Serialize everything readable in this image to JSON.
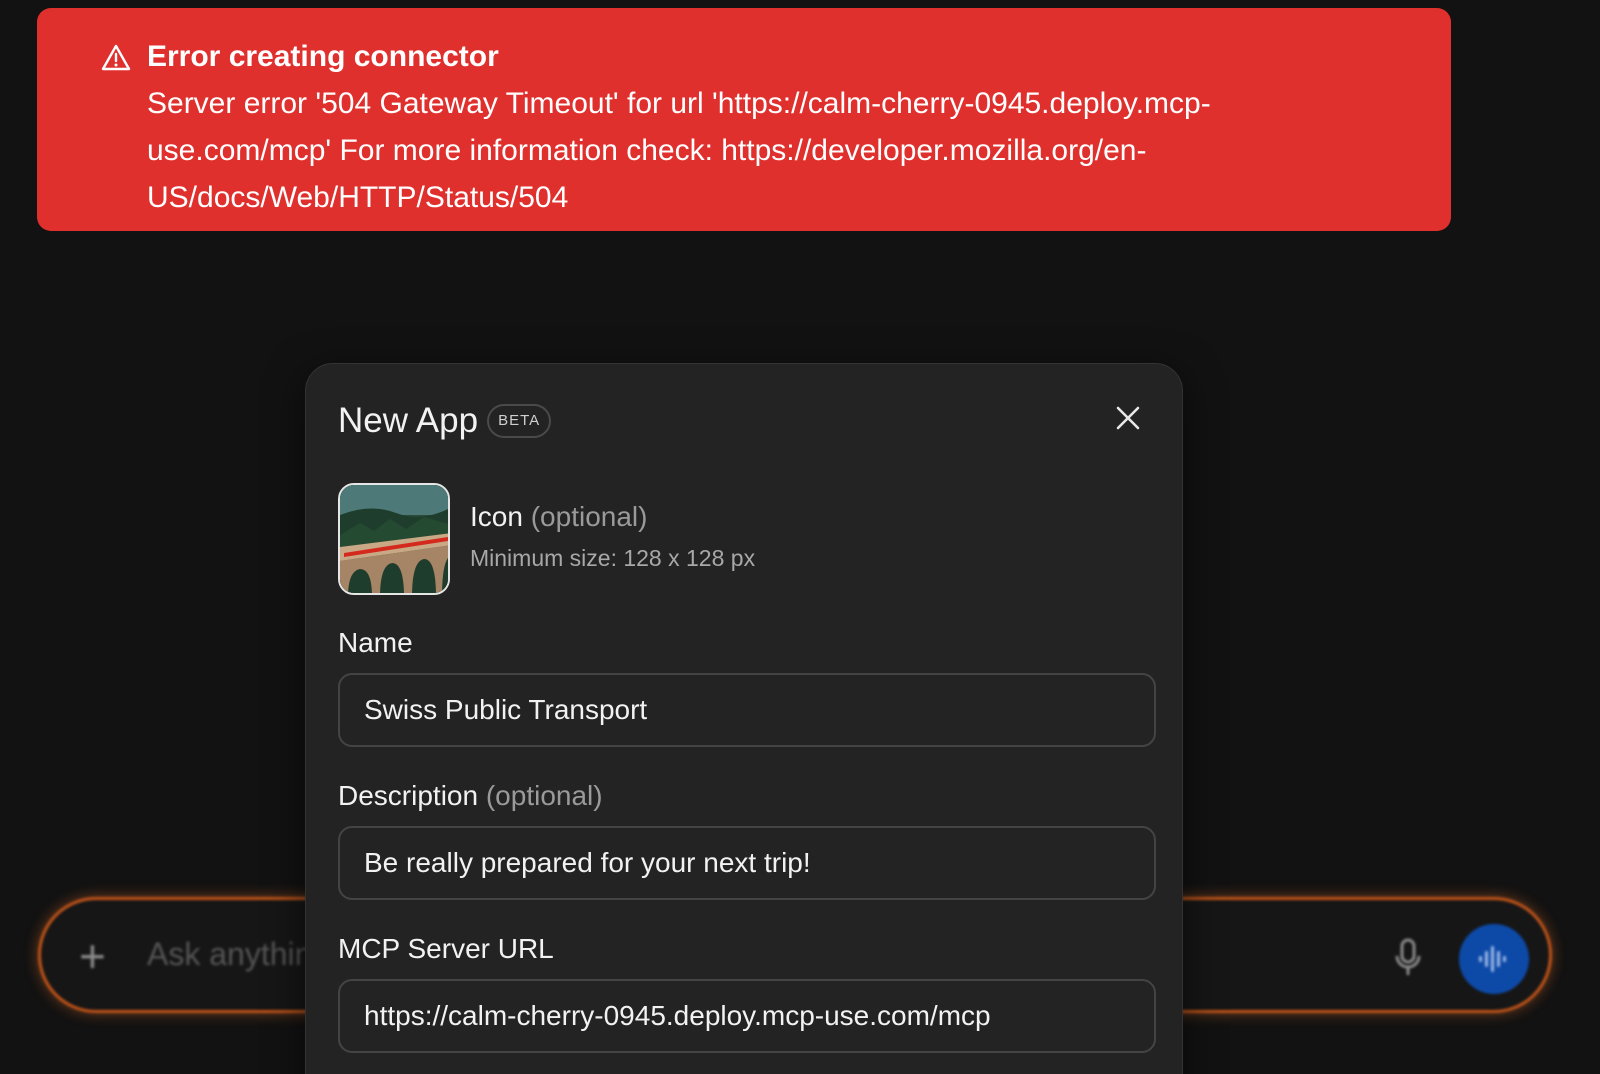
{
  "toast": {
    "title": "Error creating connector",
    "message": "Server error '504 Gateway Timeout' for url 'https://calm-cherry-0945.deploy.mcp-use.com/mcp' For more information check: https://developer.mozilla.org/en-US/docs/Web/HTTP/Status/504",
    "icon": "warning-triangle-icon",
    "color": "#e0302e"
  },
  "chat": {
    "placeholder": "Ask anything",
    "accent_color": "#c05419",
    "voice_button_color": "#0d4aa8"
  },
  "modal": {
    "title": "New App",
    "badge": "BETA",
    "icon_section": {
      "label": "Icon",
      "optional": "(optional)",
      "hint": "Minimum size: 128 x 128 px"
    },
    "name": {
      "label": "Name",
      "value": "Swiss Public Transport"
    },
    "description": {
      "label": "Description",
      "optional": "(optional)",
      "value": "Be really prepared for your next trip!"
    },
    "mcp_url": {
      "label": "MCP Server URL",
      "value": "https://calm-cherry-0945.deploy.mcp-use.com/mcp"
    }
  }
}
